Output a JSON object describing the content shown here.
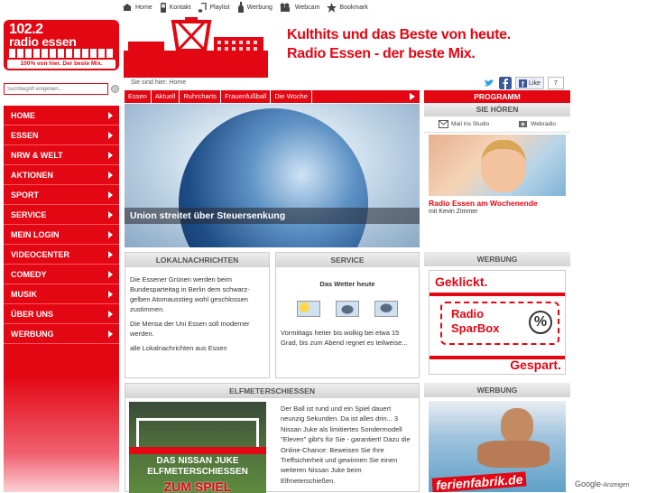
{
  "topnav": [
    {
      "label": "Home",
      "icon": "home-icon"
    },
    {
      "label": "Kontakt",
      "icon": "phone-icon"
    },
    {
      "label": "Playlist",
      "icon": "music-note-icon"
    },
    {
      "label": "Werbung",
      "icon": "bottle-icon"
    },
    {
      "label": "Webcam",
      "icon": "webcam-icon"
    },
    {
      "label": "Bookmark",
      "icon": "bookmark-icon"
    }
  ],
  "logo": {
    "line1": "102.2",
    "line2": "radio essen",
    "tagline": "100% von hier. Der beste Mix."
  },
  "banner": {
    "line1": "Kulthits und das Beste von heute.",
    "line2": "Radio Essen - der beste Mix."
  },
  "breadcrumb": "Sie sind hier: Home",
  "social": {
    "like_label": "Like",
    "like_count": "7"
  },
  "search": {
    "placeholder": "Suchbegriff eingeben..."
  },
  "sidenav": [
    "HOME",
    "ESSEN",
    "NRW & WELT",
    "AKTIONEN",
    "SPORT",
    "SERVICE",
    "MEIN LOGIN",
    "VIDEOCENTER",
    "COMEDY",
    "MUSIK",
    "ÜBER UNS",
    "WERBUNG"
  ],
  "tabs": [
    "Essen",
    "Aktuell",
    "Ruhrcharts",
    "Frauenfußball",
    "Die Woche"
  ],
  "hero": {
    "caption": "Union streitet über Steuersenkung"
  },
  "lokal": {
    "title": "LOKALNACHRICHTEN",
    "p1": "Die Essener Grünen werden beim Bundesparteitag in Berlin dem schwarz-gelben Atomausstieg wohl geschlossen zustimmen.",
    "p2": "Die Mensa der Uni Essen soll moderner werden.",
    "link": "alle Lokalnachrichten aus Essen"
  },
  "service": {
    "title": "SERVICE",
    "subtitle": "Das Wetter heute",
    "text": "Vormittags heiter bis wolkig bei etwa 15 Grad, bis zum Abend regnet es teilweise..."
  },
  "werbung1": {
    "title": "WERBUNG",
    "line1": "Geklickt.",
    "line2": "Radio",
    "line3": "SparBox",
    "line4": "Gespart.",
    "percent": "%"
  },
  "programm": {
    "title": "PROGRAMM",
    "subtitle": "SIE HÖREN",
    "mail": "Mail ins Studio",
    "webradio": "Webradio",
    "show": "Radio Essen am Wochenende",
    "host": "mit Kevin Zimmer"
  },
  "elfmeter": {
    "title": "ELFMETERSCHIESSEN",
    "img_line1": "DAS NISSAN JUKE",
    "img_line2": "ELFMETERSCHIESSEN",
    "img_line3": "ZUM SPIEL",
    "text": "Der Ball ist rund und ein Spiel dauert neunzig Sekunden. Da ist alles drin... 3 Nissan Juke als limitiertes Sondermodell \"Eleven\" gibt's für Sie - garantiert! Dazu die Online-Chance: Beweisen Sie Ihre Treffsicherheit und gewinnen Sie einen weiteren Nissan Juke beim Elfmeterschießen."
  },
  "werbung2": {
    "title": "WERBUNG",
    "brand": "ferienfabrik.de"
  },
  "google": {
    "brand": "Google",
    "label": "-Anzeigen"
  }
}
